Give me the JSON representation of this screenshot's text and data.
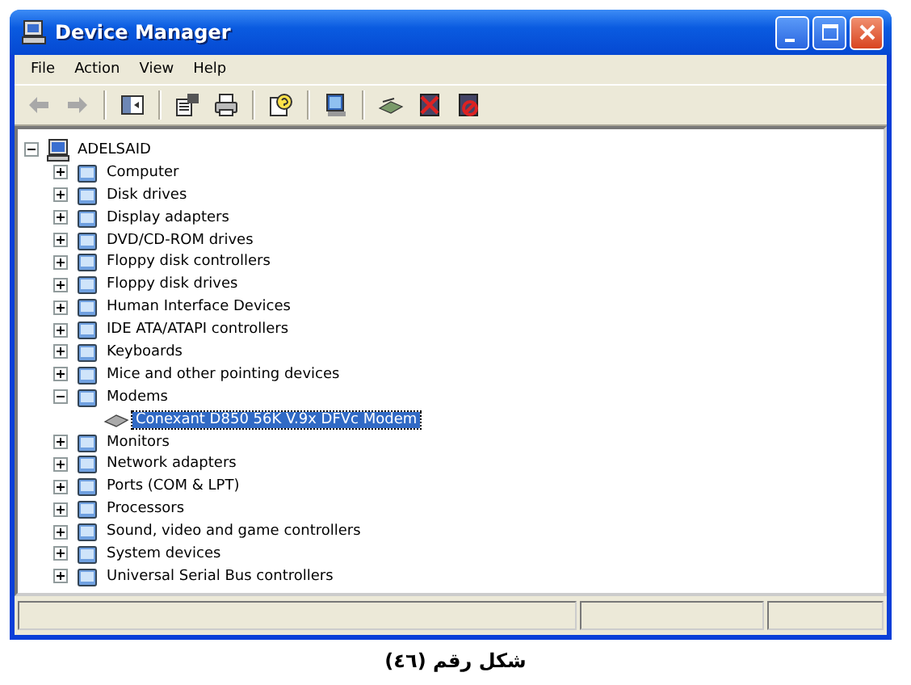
{
  "window": {
    "title": "Device Manager"
  },
  "menu": [
    {
      "label": "File"
    },
    {
      "label": "Action"
    },
    {
      "label": "View"
    },
    {
      "label": "Help"
    }
  ],
  "toolbar": [
    {
      "kind": "back",
      "disabled": true
    },
    {
      "kind": "forward",
      "disabled": true
    },
    {
      "kind": "separator"
    },
    {
      "kind": "tree-pane"
    },
    {
      "kind": "separator"
    },
    {
      "kind": "properties"
    },
    {
      "kind": "print"
    },
    {
      "kind": "separator"
    },
    {
      "kind": "help"
    },
    {
      "kind": "separator"
    },
    {
      "kind": "scan"
    },
    {
      "kind": "separator"
    },
    {
      "kind": "update"
    },
    {
      "kind": "uninstall"
    },
    {
      "kind": "disable"
    }
  ],
  "tree": [
    {
      "label": "ADELSAID",
      "expanded": true,
      "selected": false,
      "children": [
        {
          "label": "Computer",
          "expanded": false,
          "selected": false
        },
        {
          "label": "Disk drives",
          "expanded": false,
          "selected": false
        },
        {
          "label": "Display adapters",
          "expanded": false,
          "selected": false
        },
        {
          "label": "DVD/CD-ROM drives",
          "expanded": false,
          "selected": false
        },
        {
          "label": "Floppy disk controllers",
          "expanded": false,
          "selected": false
        },
        {
          "label": "Floppy disk drives",
          "expanded": false,
          "selected": false
        },
        {
          "label": "Human Interface Devices",
          "expanded": false,
          "selected": false
        },
        {
          "label": "IDE ATA/ATAPI controllers",
          "expanded": false,
          "selected": false
        },
        {
          "label": "Keyboards",
          "expanded": false,
          "selected": false
        },
        {
          "label": "Mice and other pointing devices",
          "expanded": false,
          "selected": false
        },
        {
          "label": "Modems",
          "expanded": true,
          "selected": false,
          "children": [
            {
              "label": "Conexant D850 56K V.9x DFVc Modem",
              "selected": true
            }
          ]
        },
        {
          "label": "Monitors",
          "expanded": false,
          "selected": false
        },
        {
          "label": "Network adapters",
          "expanded": false,
          "selected": false
        },
        {
          "label": "Ports (COM & LPT)",
          "expanded": false,
          "selected": false
        },
        {
          "label": "Processors",
          "expanded": false,
          "selected": false
        },
        {
          "label": "Sound, video and game controllers",
          "expanded": false,
          "selected": false
        },
        {
          "label": "System devices",
          "expanded": false,
          "selected": false
        },
        {
          "label": "Universal Serial Bus controllers",
          "expanded": false,
          "selected": false
        }
      ]
    }
  ],
  "caption": "شكل رقم (٤٦)"
}
